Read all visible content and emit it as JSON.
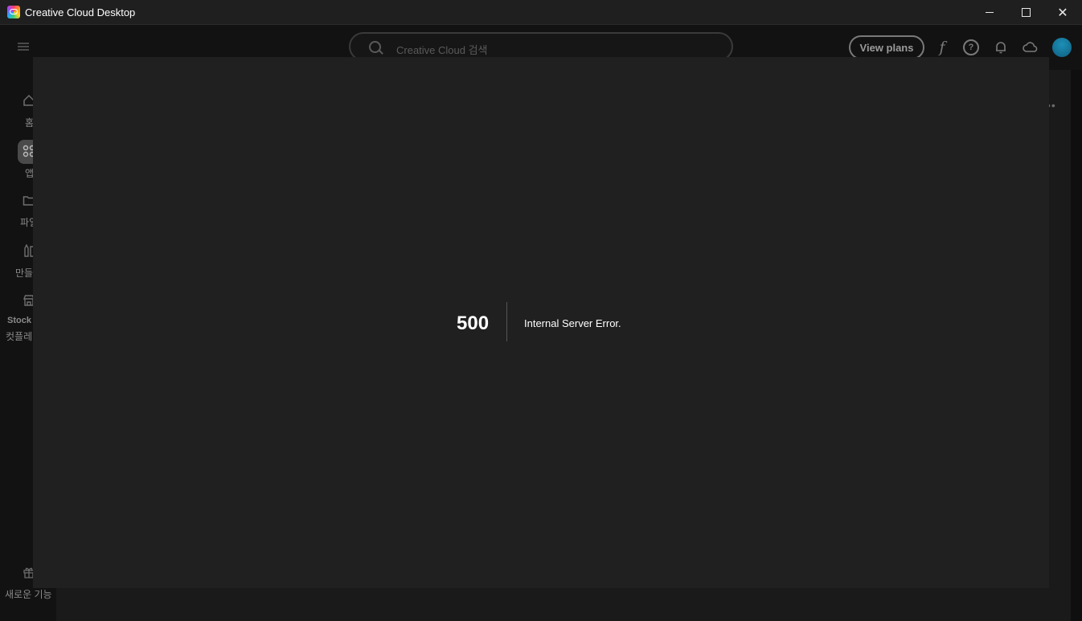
{
  "window": {
    "title": "Creative Cloud Desktop",
    "controls": {
      "minimize": "",
      "maximize": "",
      "close": "✕"
    }
  },
  "topbar": {
    "search_placeholder": "Creative Cloud 검색",
    "view_plans_label": "View plans",
    "fonts_icon_glyph": "f",
    "help_glyph": "?"
  },
  "sidebar": {
    "items": [
      {
        "label": "홈",
        "icon": "home-icon"
      },
      {
        "label": "앱",
        "icon": "apps-icon"
      },
      {
        "label": "파일",
        "icon": "folder-icon"
      },
      {
        "label": "만들",
        "icon": "create-icon"
      },
      {
        "label": "Stock",
        "label2": "컷플레",
        "icon": "stock-icon"
      }
    ],
    "whats_new_label": "새로운 기능"
  },
  "error": {
    "code": "500",
    "message": "Internal Server Error."
  },
  "colors": {
    "overlay_bg": "#202020",
    "avatar": "#1d8fb6"
  }
}
